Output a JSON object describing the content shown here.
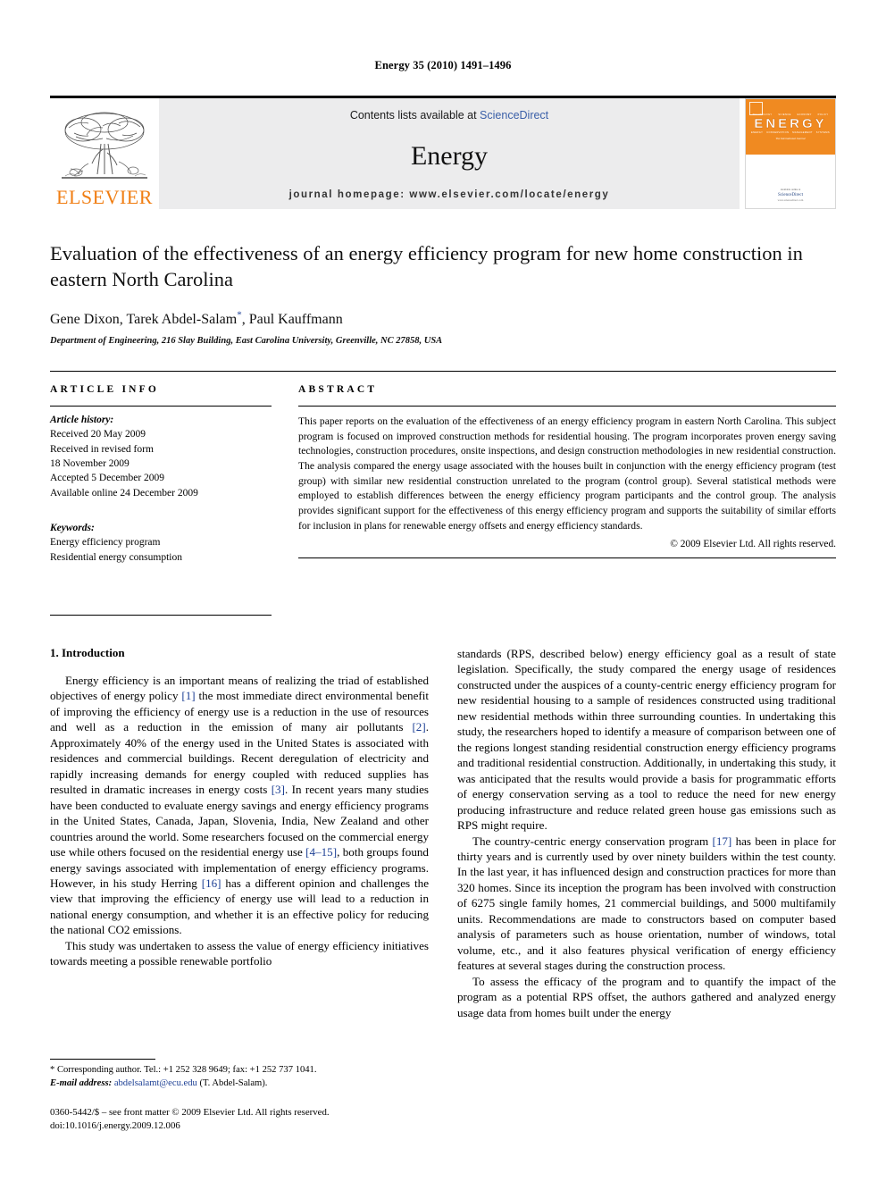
{
  "running_head": "Energy 35 (2010) 1491–1496",
  "masthead": {
    "publisher_name": "ELSEVIER",
    "contents_prefix": "Contents lists available at ",
    "contents_link": "ScienceDirect",
    "journal_name": "Energy",
    "homepage_line": "journal homepage: www.elsevier.com/locate/energy",
    "cover": {
      "title": "ENERGY",
      "subtitle": "The International Journal",
      "micro_row_top": [
        "TECHNOLOGY",
        "SCIENCE",
        "ECONOMY",
        "POLICY"
      ],
      "micro_row_bottom": [
        "ENERGY",
        "CONSERVATION",
        "MANAGEMENT",
        "SYSTEMS"
      ],
      "available_at": "Available online at",
      "sciencedirect": "ScienceDirect",
      "url": "www.sciencedirect.com"
    }
  },
  "article": {
    "title": "Evaluation of the effectiveness of an energy efficiency program for new home construction in eastern North Carolina",
    "authors": "Gene Dixon, Tarek Abdel-Salam, Paul Kauffmann",
    "author_marker": "*",
    "affiliation": "Department of Engineering, 216 Slay Building, East Carolina University, Greenville, NC 27858, USA"
  },
  "article_info": {
    "label": "ARTICLE INFO",
    "history_label": "Article history:",
    "history": [
      "Received 20 May 2009",
      "Received in revised form",
      "18 November 2009",
      "Accepted 5 December 2009",
      "Available online 24 December 2009"
    ],
    "keywords_label": "Keywords:",
    "keywords": [
      "Energy efficiency program",
      "Residential energy consumption"
    ]
  },
  "abstract": {
    "label": "ABSTRACT",
    "text": "This paper reports on the evaluation of the effectiveness of an energy efficiency program in eastern North Carolina. This subject program is focused on improved construction methods for residential housing. The program incorporates proven energy saving technologies, construction procedures, onsite inspections, and design construction methodologies in new residential construction. The analysis compared the energy usage associated with the houses built in conjunction with the energy efficiency program (test group) with similar new residential construction unrelated to the program (control group). Several statistical methods were employed to establish differences between the energy efficiency program participants and the control group. The analysis provides significant support for the effectiveness of this energy efficiency program and supports the suitability of similar efforts for inclusion in plans for renewable energy offsets and energy efficiency standards.",
    "copyright": "© 2009 Elsevier Ltd. All rights reserved."
  },
  "body": {
    "section_number_title": "1.  Introduction",
    "left_paragraphs": [
      {
        "segments": [
          {
            "t": "Energy efficiency is an important means of realizing the triad of established objectives of energy policy "
          },
          {
            "t": "[1]",
            "ref": true
          },
          {
            "t": " the most immediate direct environmental benefit of improving the efficiency of energy use is a reduction in the use of resources and well as a reduction in the emission of many air pollutants "
          },
          {
            "t": "[2]",
            "ref": true
          },
          {
            "t": ". Approximately 40% of the energy used in the United States is associated with residences and commercial buildings. Recent deregulation of electricity and rapidly increasing demands for energy coupled with reduced supplies has resulted in dramatic increases in energy costs "
          },
          {
            "t": "[3]",
            "ref": true
          },
          {
            "t": ". In recent years many studies have been conducted to evaluate energy savings and energy efficiency programs in the United States, Canada, Japan, Slovenia, India, New Zealand and other countries around the world. Some researchers focused on the commercial energy use while others focused on the residential energy use "
          },
          {
            "t": "[4–15]",
            "ref": true
          },
          {
            "t": ", both groups found energy savings associated with implementation of energy efficiency programs. However, in his study Herring "
          },
          {
            "t": "[16]",
            "ref": true
          },
          {
            "t": " has a different opinion and challenges the view that improving the efficiency of energy use will lead to a reduction in national energy consumption, and whether it is an effective policy for reducing the national CO2 emissions."
          }
        ]
      },
      {
        "segments": [
          {
            "t": "This study was undertaken to assess the value of energy efficiency initiatives towards meeting a possible renewable portfolio"
          }
        ]
      }
    ],
    "right_paragraphs": [
      {
        "continued": true,
        "segments": [
          {
            "t": "standards (RPS, described below) energy efficiency goal as a result of state legislation. Specifically, the study compared the energy usage of residences constructed under the auspices of a county-centric energy efficiency program for new residential housing to a sample of residences constructed using traditional new residential methods within three surrounding counties. In undertaking this study, the researchers hoped to identify a measure of comparison between one of the regions longest standing residential construction energy efficiency programs and traditional residential construction. Additionally, in undertaking this study, it was anticipated that the results would provide a basis for programmatic efforts of energy conservation serving as a tool to reduce the need for new energy producing infrastructure and reduce related green house gas emissions such as RPS might require."
          }
        ]
      },
      {
        "segments": [
          {
            "t": "The country-centric energy conservation program "
          },
          {
            "t": "[17]",
            "ref": true
          },
          {
            "t": " has been in place for thirty years and is currently used by over ninety builders within the test county. In the last year, it has influenced design and construction practices for more than 320 homes. Since its inception the program has been involved with construction of 6275 single family homes, 21 commercial buildings, and 5000 multifamily units. Recommendations are made to constructors based on computer based analysis of parameters such as house orientation, number of windows, total volume, etc., and it also features physical verification of energy efficiency features at several stages during the construction process."
          }
        ]
      },
      {
        "segments": [
          {
            "t": "To assess the efficacy of the program and to quantify the impact of the program as a potential RPS offset, the authors gathered and analyzed energy usage data from homes built under the energy"
          }
        ]
      }
    ]
  },
  "footnote": {
    "corresponding": "* Corresponding author. Tel.: +1 252 328 9649; fax: +1 252 737 1041.",
    "email_label": "E-mail address:",
    "email": "abdelsalamt@ecu.edu",
    "email_suffix": " (T. Abdel-Salam)."
  },
  "issn_line": "0360-5442/$ – see front matter © 2009 Elsevier Ltd. All rights reserved.",
  "doi_line": "doi:10.1016/j.energy.2009.12.006",
  "colors": {
    "link_blue": "#3a5fa8",
    "ref_blue": "#1c3f94",
    "elsevier_orange": "#f07e13",
    "masthead_gray": "#ececed"
  }
}
